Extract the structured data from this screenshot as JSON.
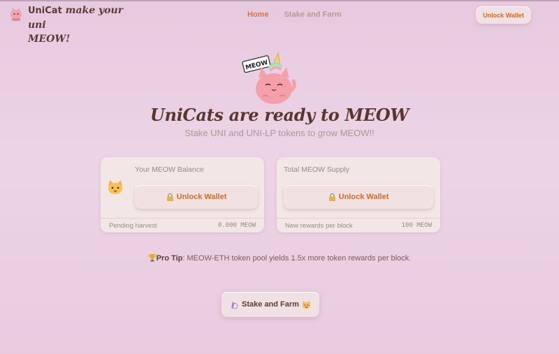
{
  "header": {
    "brand_name": "UniCat",
    "brand_tagline_line1": "make your uni",
    "brand_tagline_line2": "MEOW!",
    "nav": [
      {
        "label": "Home",
        "active": true
      },
      {
        "label": "Stake and Farm",
        "active": false
      }
    ],
    "unlock_wallet_label": "Unlock Wallet"
  },
  "hero": {
    "mascot_sign": "MEOW",
    "title": "UniCats are ready to MEOW",
    "subtitle": "Stake UNI and UNI-LP tokens to grow MEOW!!"
  },
  "balance_card": {
    "label": "Your MEOW Balance",
    "icon": "cat-face-icon",
    "button_label": "Unlock Wallet",
    "footer_label": "Pending harvest",
    "footer_value": "0.000 MEOW"
  },
  "supply_card": {
    "label": "Total MEOW Supply",
    "button_label": "Unlock Wallet",
    "footer_label": "New rewards per block",
    "footer_value": "100 MEOW"
  },
  "protip": {
    "label": "Pro Tip",
    "text": ": MEOW-ETH token pool yields 1.5x more token rewards per block."
  },
  "stake_farm_button": {
    "label": "Stake and Farm"
  },
  "colors": {
    "accent": "#d2692e",
    "title": "#5a3630",
    "background": "#e8c9df"
  }
}
